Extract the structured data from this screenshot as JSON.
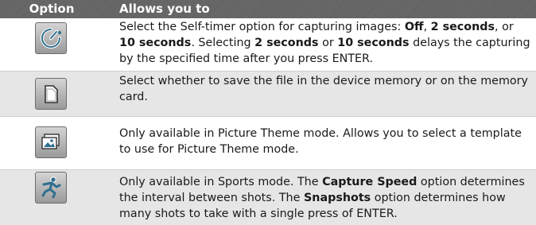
{
  "header": {
    "option": "Option",
    "allows": "Allows you to"
  },
  "rows": [
    {
      "icon": "self-timer-icon",
      "parts": [
        {
          "t": "Select the Self-timer option for capturing images: ",
          "b": false
        },
        {
          "t": "Off",
          "b": true
        },
        {
          "t": ", ",
          "b": false
        },
        {
          "t": "2 seconds",
          "b": true
        },
        {
          "t": ", or ",
          "b": false
        },
        {
          "t": "10 seconds",
          "b": true
        },
        {
          "t": ". Selecting ",
          "b": false
        },
        {
          "t": "2 seconds",
          "b": true
        },
        {
          "t": " or ",
          "b": false
        },
        {
          "t": "10 seconds",
          "b": true
        },
        {
          "t": " delays the capturing by the specified time after you press ENTER.",
          "b": false
        }
      ]
    },
    {
      "icon": "storage-card-icon",
      "parts": [
        {
          "t": "Select whether to save the file in the device memory or on the memory card.",
          "b": false
        }
      ]
    },
    {
      "icon": "picture-theme-icon",
      "parts": [
        {
          "t": "Only available in Picture Theme mode. Allows you to select a template to use for Picture Theme mode.",
          "b": false
        }
      ]
    },
    {
      "icon": "sports-mode-icon",
      "parts": [
        {
          "t": "Only available in Sports mode. The ",
          "b": false
        },
        {
          "t": "Capture Speed",
          "b": true
        },
        {
          "t": " option determines the interval between shots. The ",
          "b": false
        },
        {
          "t": "Snapshots",
          "b": true
        },
        {
          "t": " option determines how many shots to take with a single press of ENTER.",
          "b": false
        }
      ]
    }
  ]
}
